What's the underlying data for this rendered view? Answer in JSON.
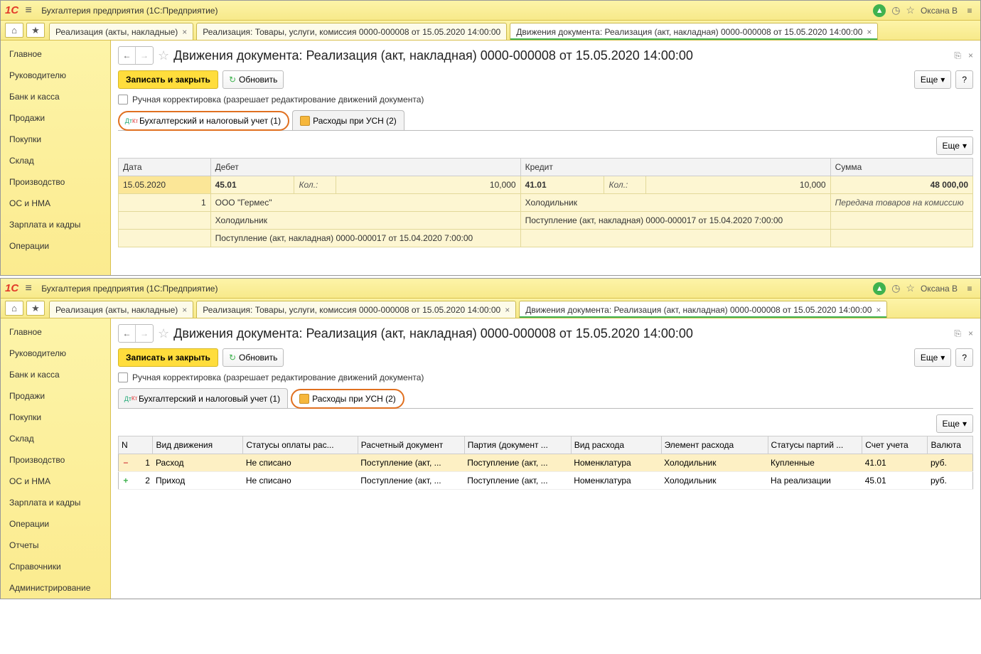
{
  "app": {
    "title": "Бухгалтерия предприятия  (1С:Предприятие)",
    "username": "Оксана В"
  },
  "tabs": [
    "Реализация (акты, накладные)",
    "Реализация: Товары, услуги, комиссия 0000-000008 от 15.05.2020 14:00:00",
    "Движения документа: Реализация (акт, накладная) 0000-000008 от 15.05.2020 14:00:00"
  ],
  "sidebar": [
    "Главное",
    "Руководителю",
    "Банк и касса",
    "Продажи",
    "Покупки",
    "Склад",
    "Производство",
    "ОС и НМА",
    "Зарплата и кадры",
    "Операции",
    "Отчеты",
    "Справочники",
    "Администрирование"
  ],
  "heading": "Движения документа: Реализация (акт, накладная) 0000-000008 от 15.05.2020 14:00:00",
  "buttons": {
    "saveClose": "Записать и закрыть",
    "refresh": "Обновить",
    "more": "Еще",
    "help": "?"
  },
  "checkboxLabel": "Ручная корректировка (разрешает редактирование движений документа)",
  "innerTabs": {
    "tab1": "Бухгалтерский и налоговый учет (1)",
    "tab2": "Расходы при УСН (2)"
  },
  "acctHeaders": {
    "date": "Дата",
    "debit": "Дебет",
    "credit": "Кредит",
    "sum": "Сумма"
  },
  "acct": {
    "date": "15.05.2020",
    "rowNum": "1",
    "debitAcc": "45.01",
    "debitKolLabel": "Кол.:",
    "debitKol": "10,000",
    "creditAcc": "41.01",
    "creditKolLabel": "Кол.:",
    "creditKol": "10,000",
    "sum": "48 000,00",
    "debitSub1": "ООО \"Гермес\"",
    "creditSub1": "Холодильник",
    "sumDesc": "Передача товаров на комиссию",
    "debitSub2": "Холодильник",
    "creditSub2": "Поступление (акт, накладная) 0000-000017 от 15.04.2020 7:00:00",
    "debitSub3": "Поступление (акт, накладная) 0000-000017 от 15.04.2020 7:00:00"
  },
  "gridHeaders": {
    "n": "N",
    "type": "Вид движения",
    "payStatus": "Статусы оплаты рас...",
    "doc": "Расчетный документ",
    "party": "Партия (документ ...",
    "expType": "Вид расхода",
    "expElem": "Элемент расхода",
    "partyStatus": "Статусы партий ...",
    "account": "Счет учета",
    "currency": "Валюта"
  },
  "gridRows": [
    {
      "icon": "-",
      "n": "1",
      "type": "Расход",
      "payStatus": "Не списано",
      "doc": "Поступление (акт, ...",
      "party": "Поступление (акт, ...",
      "expType": "Номенклатура",
      "expElem": "Холодильник",
      "partyStatus": "Купленные",
      "account": "41.01",
      "currency": "руб."
    },
    {
      "icon": "+",
      "n": "2",
      "type": "Приход",
      "payStatus": "Не списано",
      "doc": "Поступление (акт, ...",
      "party": "Поступление (акт, ...",
      "expType": "Номенклатура",
      "expElem": "Холодильник",
      "partyStatus": "На реализации",
      "account": "45.01",
      "currency": "руб."
    }
  ]
}
